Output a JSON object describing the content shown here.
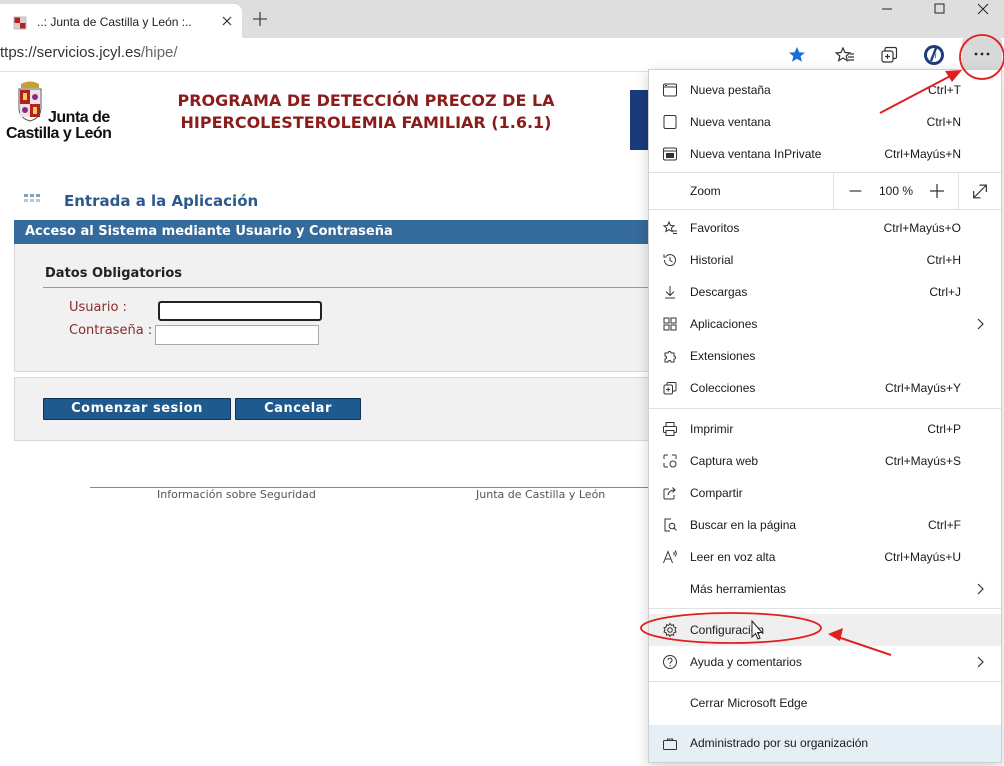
{
  "browser": {
    "tab_title": "..: Junta de Castilla y León :..",
    "address_prefix": "ttps://servicios.jcyl.es",
    "address_path": "/hipe/"
  },
  "page": {
    "logo_line1": "Junta de",
    "logo_line2": "Castilla y León",
    "program_title_line1": "PROGRAMA DE DETECCIÓN PRECOZ DE LA",
    "program_title_line2": "HIPERCOLESTEROLEMIA FAMILIAR (1.6.1)",
    "entry_title": "Entrada a la Aplicación",
    "access_bar": "Acceso al Sistema mediante Usuario y Contraseña",
    "required_title": "Datos Obligatorios",
    "user_label": "Usuario :",
    "pass_label": "Contraseña :",
    "user_value": "",
    "pass_value": "",
    "start_button": "Comenzar sesion",
    "cancel_button": "Cancelar",
    "footer_security": "Información sobre Seguridad",
    "footer_junta": "Junta de Castilla y León"
  },
  "menu": {
    "new_tab": {
      "label": "Nueva pestaña",
      "shortcut": "Ctrl+T"
    },
    "new_window": {
      "label": "Nueva ventana",
      "shortcut": "Ctrl+N"
    },
    "inprivate": {
      "label": "Nueva ventana InPrivate",
      "shortcut": "Ctrl+Mayús+N"
    },
    "zoom": {
      "label": "Zoom",
      "value": "100 %"
    },
    "favorites": {
      "label": "Favoritos",
      "shortcut": "Ctrl+Mayús+O"
    },
    "history": {
      "label": "Historial",
      "shortcut": "Ctrl+H"
    },
    "downloads": {
      "label": "Descargas",
      "shortcut": "Ctrl+J"
    },
    "apps": {
      "label": "Aplicaciones"
    },
    "extensions": {
      "label": "Extensiones"
    },
    "collections": {
      "label": "Colecciones",
      "shortcut": "Ctrl+Mayús+Y"
    },
    "print": {
      "label": "Imprimir",
      "shortcut": "Ctrl+P"
    },
    "web_capture": {
      "label": "Captura web",
      "shortcut": "Ctrl+Mayús+S"
    },
    "share": {
      "label": "Compartir"
    },
    "find": {
      "label": "Buscar en la página",
      "shortcut": "Ctrl+F"
    },
    "read_aloud": {
      "label": "Leer en voz alta",
      "shortcut": "Ctrl+Mayús+U"
    },
    "more_tools": {
      "label": "Más herramientas"
    },
    "settings": {
      "label": "Configuración"
    },
    "help": {
      "label": "Ayuda y comentarios"
    },
    "close_edge": {
      "label": "Cerrar Microsoft Edge"
    },
    "managed": {
      "label": "Administrado por su organización"
    }
  },
  "colors": {
    "title_red": "#8b1c1c",
    "header_blue": "#356a9c",
    "button_blue": "#1f5a8e",
    "annotation_red": "#e02020"
  },
  "icons": [
    "tab-favicon",
    "close-icon",
    "plus-icon",
    "minimize-icon",
    "maximize-icon",
    "close-window-icon",
    "star-icon",
    "favorites-icon",
    "collections-icon",
    "profile-icon",
    "more-icon",
    "new-tab-icon",
    "new-window-icon",
    "inprivate-icon",
    "favorites-star-icon",
    "history-icon",
    "download-icon",
    "apps-icon",
    "extensions-icon",
    "collections-menu-icon",
    "print-icon",
    "web-capture-icon",
    "share-icon",
    "find-icon",
    "read-aloud-icon",
    "gear-icon",
    "help-icon",
    "briefcase-icon",
    "chevron-right-icon"
  ]
}
